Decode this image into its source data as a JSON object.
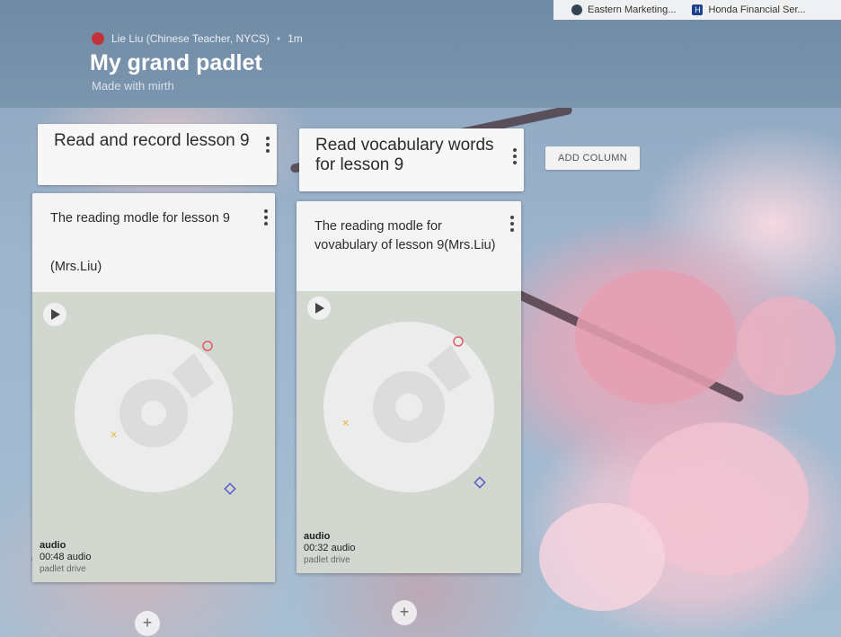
{
  "browser": {
    "bookmarks": [
      {
        "label": "Eastern Marketing...",
        "icon": "site-icon"
      },
      {
        "label": "Honda Financial Ser...",
        "icon": "honda-icon"
      }
    ]
  },
  "padlet": {
    "author": "Lie Liu (Chinese Teacher, NYCS)",
    "separator": "•",
    "time": "1m",
    "title": "My grand padlet",
    "subtitle": "Made with mirth",
    "add_column_label": "ADD COLUMN",
    "columns": [
      {
        "title": "Read and record lesson 9",
        "card": {
          "title": "The reading modle for lesson 9",
          "note": "(Mrs.Liu)",
          "type_label": "audio",
          "duration": "00:48 audio",
          "source": "padlet drive"
        },
        "add_label": "+"
      },
      {
        "title": "Read vocabulary words for lesson 9",
        "card": {
          "title": "The reading modle for vovabulary of lesson 9(Mrs.Liu)",
          "note": "",
          "type_label": "audio",
          "duration": "00:32 audio",
          "source": "padlet drive"
        },
        "add_label": "+"
      }
    ]
  },
  "colors": {
    "header_bg": "#7d96af",
    "card_bg": "#f4f4f4",
    "audio_area_bg": "#d2d8cf",
    "avatar": "#c3333b"
  }
}
